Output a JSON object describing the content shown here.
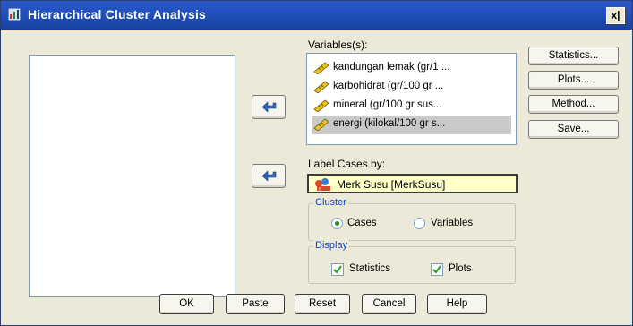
{
  "window": {
    "title": "Hierarchical Cluster Analysis",
    "close_label": "x|"
  },
  "variables": {
    "label": "Variables(s):",
    "items": [
      {
        "label": "kandungan lemak (gr/1 ...",
        "selected": false
      },
      {
        "label": "karbohidrat (gr/100 gr ...",
        "selected": false
      },
      {
        "label": "mineral (gr/100 gr sus...",
        "selected": false
      },
      {
        "label": "energi (kilokal/100 gr s...",
        "selected": true
      }
    ]
  },
  "side_buttons": {
    "statistics": "Statistics...",
    "plots": "Plots...",
    "method": "Method...",
    "save": "Save..."
  },
  "label_cases": {
    "label": "Label Cases by:",
    "value": "Merk Susu [MerkSusu]"
  },
  "cluster": {
    "title": "Cluster",
    "cases": "Cases",
    "variables": "Variables",
    "selected": "cases"
  },
  "display": {
    "title": "Display",
    "statistics": "Statistics",
    "plots": "Plots",
    "statistics_checked": true,
    "plots_checked": true
  },
  "bottom_buttons": {
    "ok": "OK",
    "paste": "Paste",
    "reset": "Reset",
    "cancel": "Cancel",
    "help": "Help"
  },
  "colors": {
    "titlebar": "#2050bd",
    "dialog_bg": "#ece9d8",
    "label_case_bg": "#ffffc8",
    "selected_row": "#c9c9c9"
  },
  "icons": {
    "variable": "ruler-scale-icon",
    "nominal": "nominal-variable-icon",
    "transfer": "transfer-arrow-icon"
  }
}
